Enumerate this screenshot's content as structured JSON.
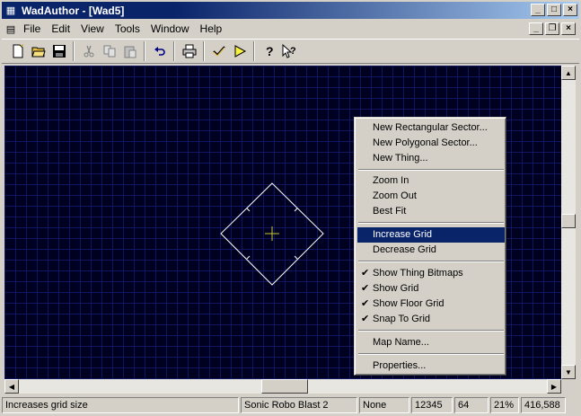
{
  "window": {
    "title": "WadAuthor - [Wad5]"
  },
  "menubar": {
    "items": [
      "File",
      "Edit",
      "View",
      "Tools",
      "Window",
      "Help"
    ]
  },
  "context_menu": {
    "items": [
      {
        "label": "New Rectangular Sector...",
        "checked": false,
        "highlighted": false
      },
      {
        "label": "New Polygonal Sector...",
        "checked": false,
        "highlighted": false
      },
      {
        "label": "New Thing...",
        "checked": false,
        "highlighted": false
      },
      {
        "label": "Zoom In",
        "checked": false,
        "highlighted": false
      },
      {
        "label": "Zoom Out",
        "checked": false,
        "highlighted": false
      },
      {
        "label": "Best Fit",
        "checked": false,
        "highlighted": false
      },
      {
        "label": "Increase Grid",
        "checked": false,
        "highlighted": true
      },
      {
        "label": "Decrease Grid",
        "checked": false,
        "highlighted": false
      },
      {
        "label": "Show Thing Bitmaps",
        "checked": true,
        "highlighted": false
      },
      {
        "label": "Show Grid",
        "checked": true,
        "highlighted": false
      },
      {
        "label": "Show Floor Grid",
        "checked": true,
        "highlighted": false
      },
      {
        "label": "Snap To Grid",
        "checked": true,
        "highlighted": false
      },
      {
        "label": "Map Name...",
        "checked": false,
        "highlighted": false
      },
      {
        "label": "Properties...",
        "checked": false,
        "highlighted": false
      }
    ]
  },
  "statusbar": {
    "message": "Increases grid size",
    "game": "Sonic Robo Blast 2",
    "mode": "None",
    "value1": "12345",
    "value2": "64",
    "zoom": "21%",
    "coords": "416,588"
  },
  "colors": {
    "canvas_bg": "#000020",
    "grid": "#0e1660",
    "highlight": "#0a246a",
    "sector_line": "#ffffff",
    "thing_marker": "#c8c832"
  },
  "icons": [
    "new-file-icon",
    "open-folder-icon",
    "save-icon",
    "cut-icon",
    "copy-icon",
    "paste-icon",
    "undo-icon",
    "print-icon",
    "check-icon",
    "run-icon",
    "help-icon",
    "context-help-icon"
  ]
}
